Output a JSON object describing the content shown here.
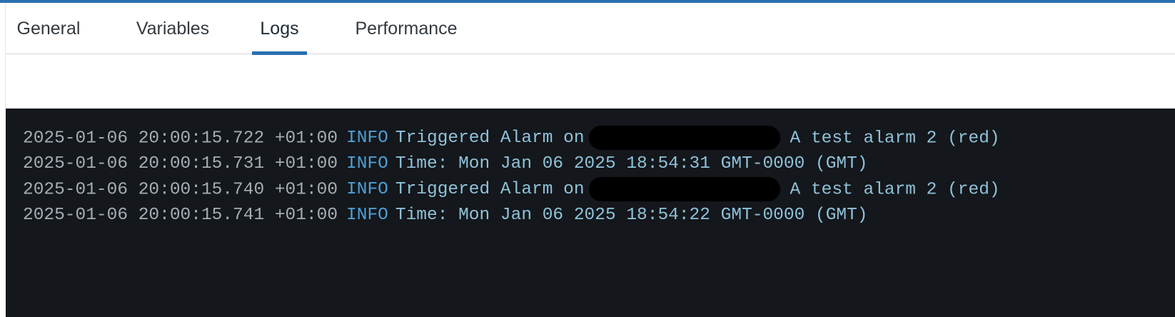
{
  "tabs": [
    {
      "label": "General"
    },
    {
      "label": "Variables"
    },
    {
      "label": "Logs"
    },
    {
      "label": "Performance"
    }
  ],
  "active_tab": "Logs",
  "logs": [
    {
      "timestamp": "2025-01-06 20:00:15.722 +01:00",
      "level": "INFO",
      "message_before": "Triggered Alarm on",
      "message_after": "A test alarm 2 (red)"
    },
    {
      "timestamp": "2025-01-06 20:00:15.731 +01:00",
      "level": "INFO",
      "message": "Time: Mon Jan 06 2025 18:54:31 GMT-0000 (GMT)"
    },
    {
      "timestamp": "2025-01-06 20:00:15.740 +01:00",
      "level": "INFO",
      "message_before": "Triggered Alarm on",
      "message_after": "A test alarm 2 (red)"
    },
    {
      "timestamp": "2025-01-06 20:00:15.741 +01:00",
      "level": "INFO",
      "message": "Time: Mon Jan 06 2025 18:54:22 GMT-0000 (GMT)"
    }
  ],
  "colors": {
    "accent": "#2a6fb0",
    "log_background": "#14171b",
    "timestamp": "#a6adb4",
    "level_info": "#4d9fd6",
    "message": "#8fc2da"
  }
}
